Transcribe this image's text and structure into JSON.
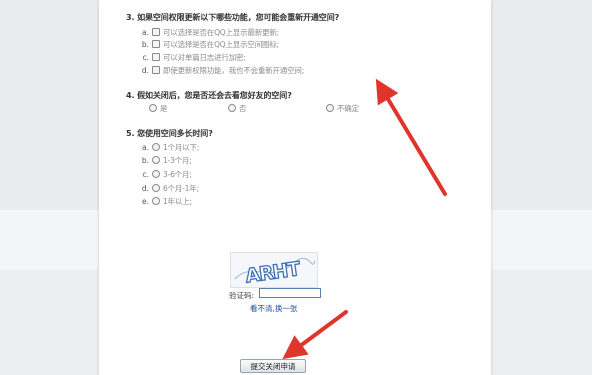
{
  "survey": {
    "q3": {
      "title": "3. 如果空间权限更新以下哪些功能，您可能会重新开通空间?",
      "options": [
        {
          "letter": "a.",
          "text": "可以选择是否在QQ上显示最新更新;"
        },
        {
          "letter": "b.",
          "text": "可以选择是否在QQ上显示空间图标;"
        },
        {
          "letter": "c.",
          "text": "可以对单篇日志进行加密;"
        },
        {
          "letter": "d.",
          "text": "即使更新权限功能，我也不会重新开通空间;"
        }
      ]
    },
    "q4": {
      "title": "4. 假如关闭后，您是否还会去看您好友的空间?",
      "options": [
        {
          "text": "是"
        },
        {
          "text": "否"
        },
        {
          "text": "不确定"
        }
      ]
    },
    "q5": {
      "title": "5. 您使用空间多长时间?",
      "options": [
        {
          "letter": "a.",
          "text": "1个月以下;"
        },
        {
          "letter": "b.",
          "text": "1-3个月;"
        },
        {
          "letter": "c.",
          "text": "3-6个月;"
        },
        {
          "letter": "d.",
          "text": "6个月-1年;"
        },
        {
          "letter": "e.",
          "text": "1年以上;"
        }
      ]
    }
  },
  "captcha": {
    "image_text": "ARHT",
    "label": "验证码:",
    "input_value": "",
    "refresh_link": "看不清,换一张"
  },
  "submit_label": "提交关闭申请",
  "colors": {
    "arrow": "#e0352b",
    "link": "#1f4fa0",
    "captcha_text": "#3f6fb0"
  }
}
